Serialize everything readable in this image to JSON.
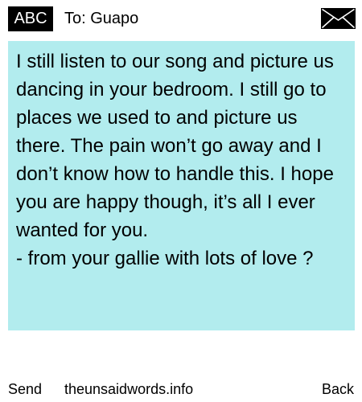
{
  "header": {
    "badge_label": "ABC",
    "to_label": "To: Guapo",
    "envelope_icon": "envelope-icon"
  },
  "message": {
    "body": "I still listen to our song and picture us dancing in your bedroom. I still go to places we used to and picture us there. The pain won’t go away and I don’t know how to handle this. I hope you are happy though, it’s all I ever wanted for you.\n- from your gallie with lots of love ?",
    "background_color": "#b2ecee"
  },
  "footer": {
    "send_label": "Send",
    "site_label": "theunsaidwords.info",
    "back_label": "Back"
  }
}
